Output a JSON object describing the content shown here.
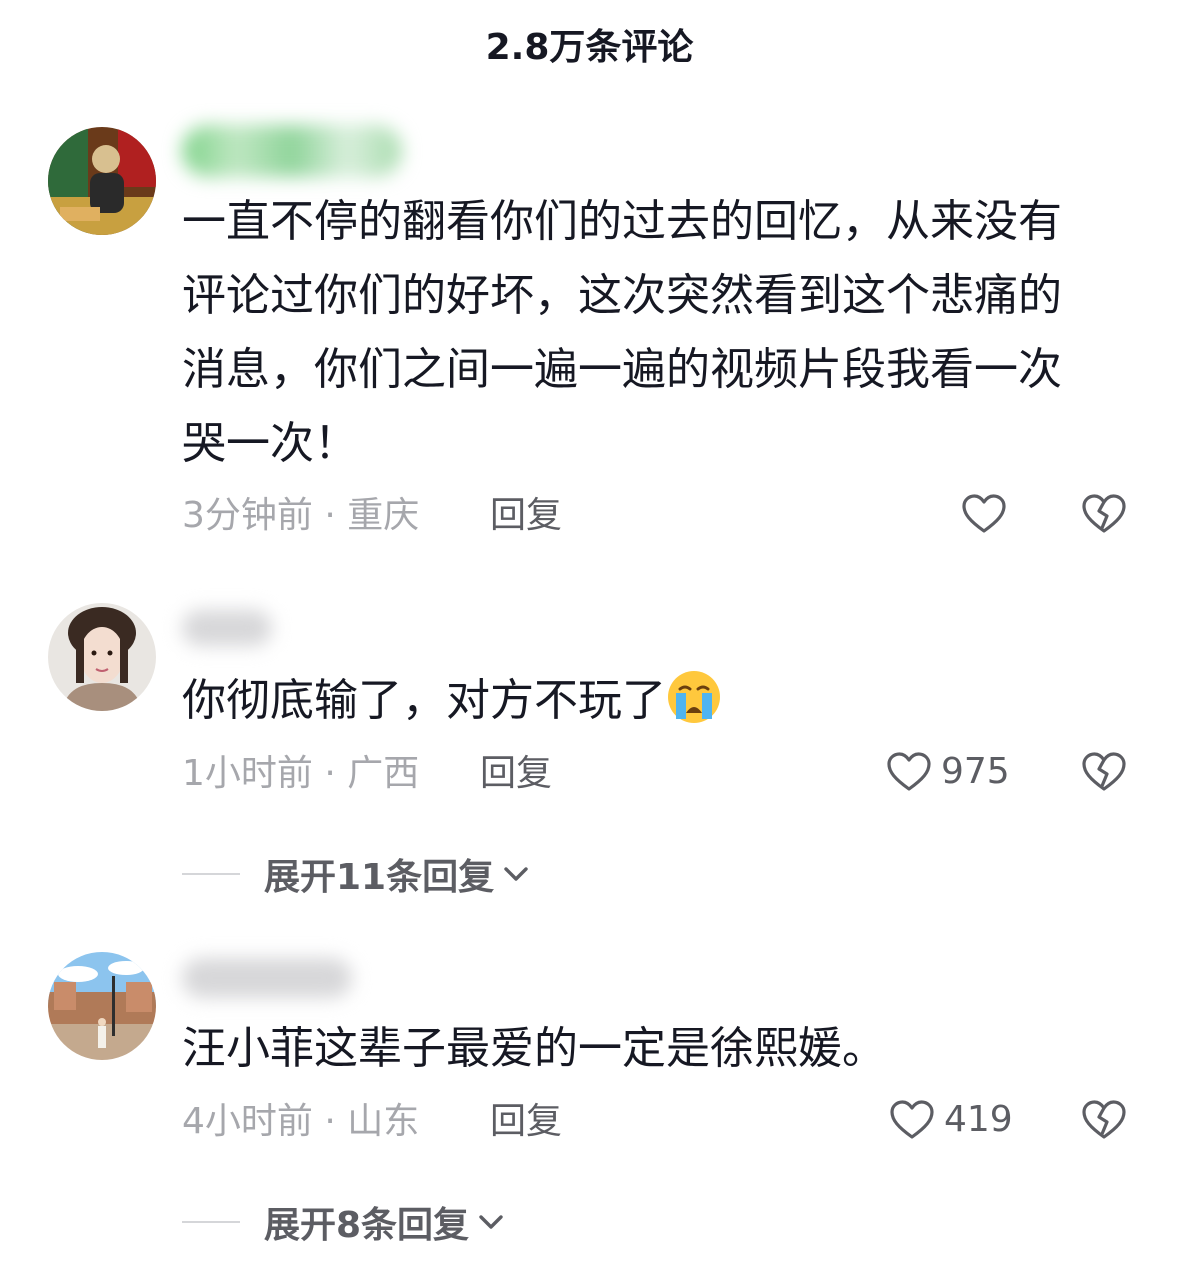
{
  "header": {
    "title": "2.8万条评论"
  },
  "comments": [
    {
      "content": "一直不停的翻看你们的过去的回忆，从来没有评论过你们的好坏，这次突然看到这个悲痛的消息，你们之间一遍一遍的视频片段我看一次哭一次！",
      "time_location": "3分钟前 · 重庆",
      "reply_label": "回复",
      "likes": ""
    },
    {
      "content": "你彻底输了，对方不玩了",
      "emoji": "crying-face-emoji",
      "time_location": "1小时前 · 广西",
      "reply_label": "回复",
      "likes": "975",
      "expand_label": "展开11条回复"
    },
    {
      "content": "汪小菲这辈子最爱的一定是徐熙媛。",
      "time_location": "4小时前 · 山东",
      "reply_label": "回复",
      "likes": "419",
      "expand_label": "展开8条回复"
    }
  ],
  "colors": {
    "text_primary": "#161823",
    "text_secondary": "#a6a7ac",
    "action": "#5c5d63"
  }
}
